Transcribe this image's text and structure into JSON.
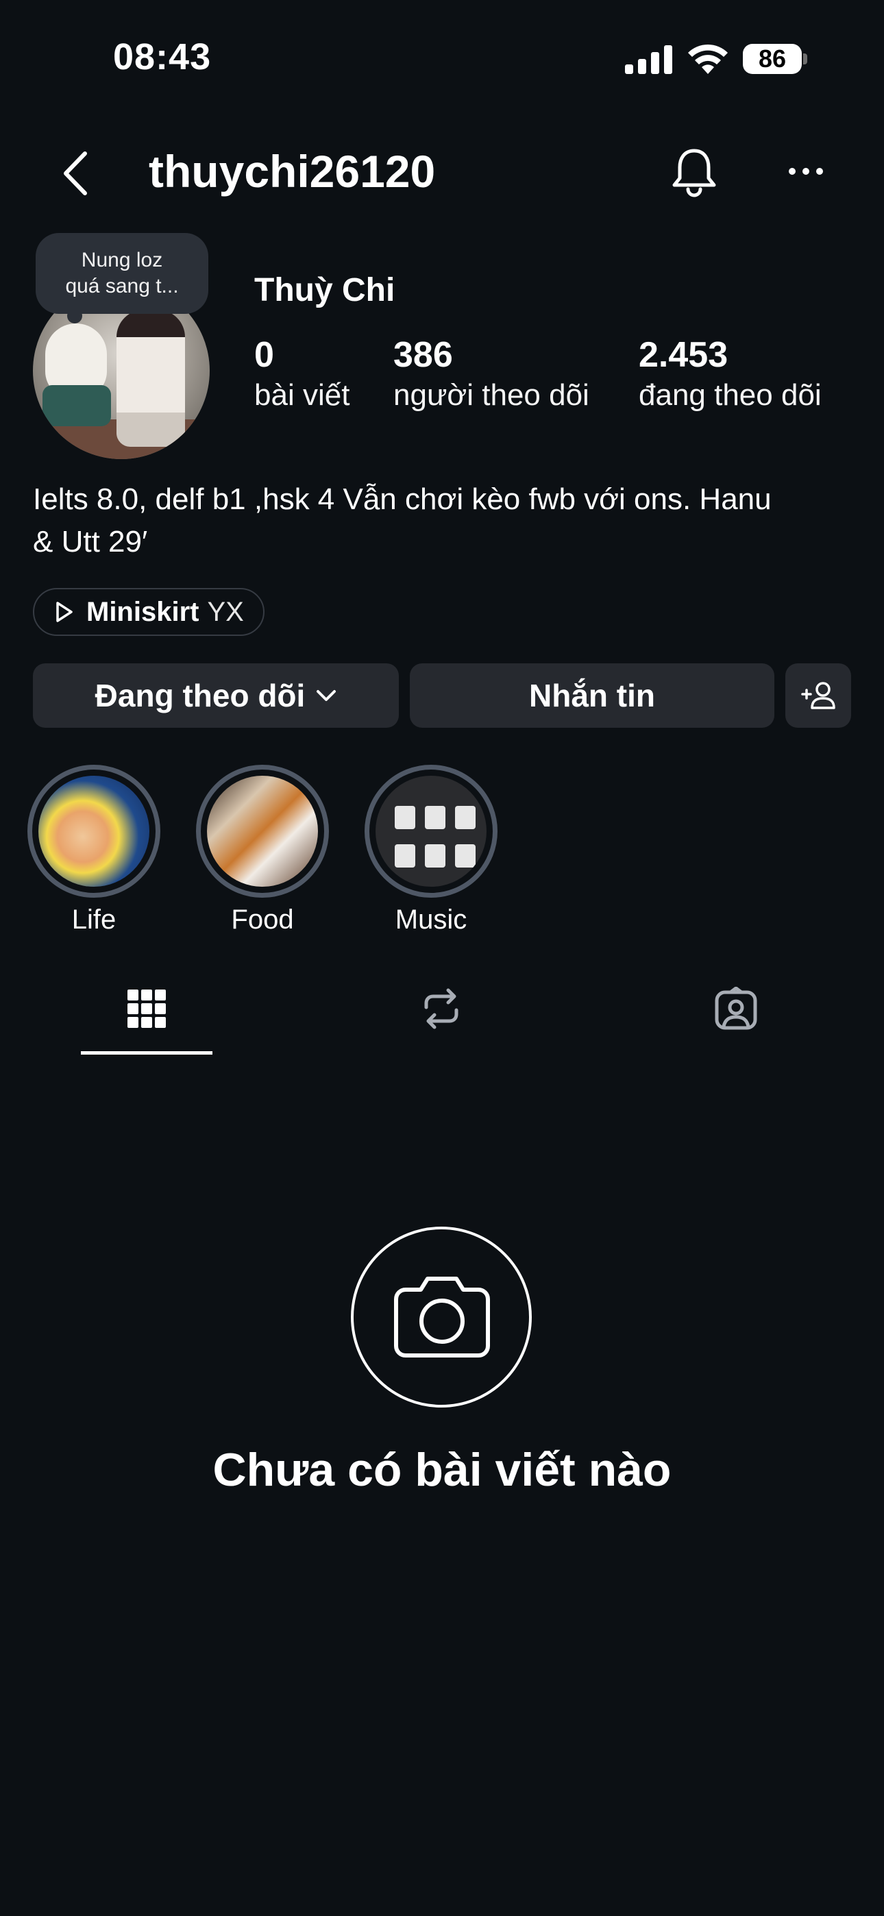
{
  "status_bar": {
    "time": "08:43",
    "battery": "86"
  },
  "header": {
    "username": "thuychi26120"
  },
  "note": {
    "line1": "Nung loz",
    "line2": "quá sang t..."
  },
  "profile": {
    "full_name": "Thuỳ Chi",
    "stats": [
      {
        "value": "0",
        "label": "bài viết"
      },
      {
        "value": "386",
        "label": "người theo dõi"
      },
      {
        "value": "2.453",
        "label": "đang theo dõi"
      }
    ],
    "bio_line1": "Ielts 8.0, delf b1 ,hsk 4 Vẫn chơi kèo fwb với ons. Hanu",
    "bio_line2": "& Utt 29′",
    "music": {
      "song": "Miniskirt",
      "artist": "YX"
    }
  },
  "actions": {
    "following_label": "Đang theo dõi",
    "message_label": "Nhắn tin"
  },
  "highlights": [
    {
      "label": "Life"
    },
    {
      "label": "Food"
    },
    {
      "label": "Music"
    }
  ],
  "tabs": [
    {
      "icon": "grid-icon",
      "active": true
    },
    {
      "icon": "reels-repost-icon",
      "active": false
    },
    {
      "icon": "tagged-icon",
      "active": false
    }
  ],
  "empty_state": {
    "title": "Chưa có bài viết nào"
  }
}
